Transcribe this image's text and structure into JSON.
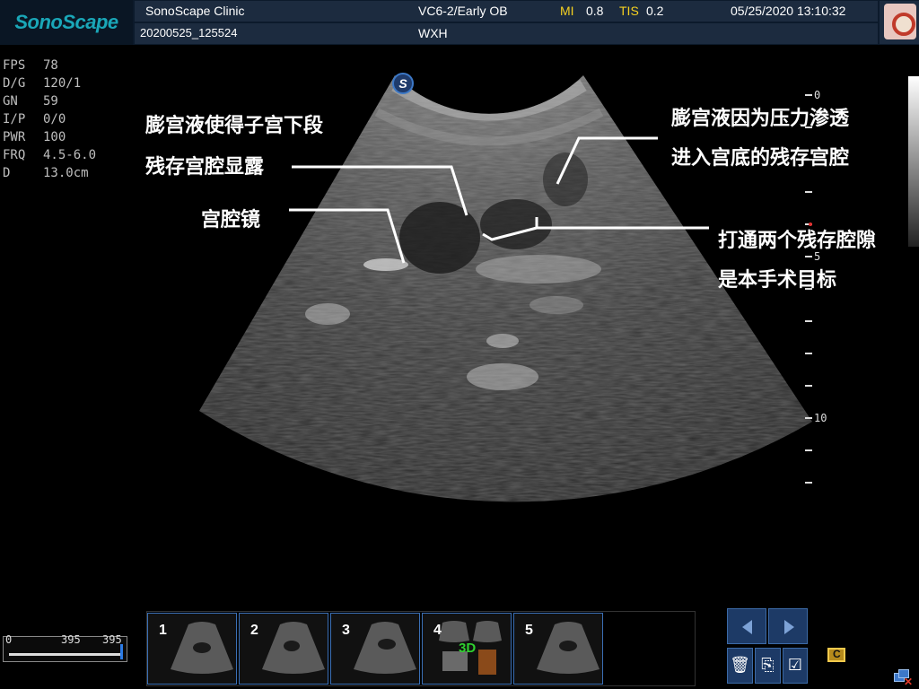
{
  "header": {
    "logo": "SonoScape",
    "clinic": "SonoScape Clinic",
    "probe_preset": "VC6-2/Early OB",
    "mi_label": "MI",
    "mi_value": "0.8",
    "tis_label": "TIS",
    "tis_value": "0.2",
    "datetime": "05/25/2020 13:10:32",
    "patient_id": "20200525_125524",
    "operator": "WXH"
  },
  "params": [
    {
      "key": "FPS",
      "value": "78"
    },
    {
      "key": "D/G",
      "value": "120/1"
    },
    {
      "key": "GN",
      "value": "59"
    },
    {
      "key": "I/P",
      "value": "0/0"
    },
    {
      "key": "PWR",
      "value": "100"
    },
    {
      "key": "FRQ",
      "value": "4.5-6.0"
    },
    {
      "key": "D",
      "value": "13.0cm"
    }
  ],
  "image": {
    "badge": "S",
    "depth_labels": [
      "0",
      "5",
      "10"
    ]
  },
  "annotations": {
    "a1_line1": "膨宫液使得子宫下段",
    "a1_line2": "残存宫腔显露",
    "a2": "宫腔镜",
    "a3_line1": "膨宫液因为压力渗透",
    "a3_line2": "进入宫底的残存宫腔",
    "a4_line1": "打通两个残存腔隙",
    "a4_line2": "是本手术目标"
  },
  "cine": {
    "start": "0",
    "current": "395",
    "total": "395",
    "position_fraction": 1.0
  },
  "thumbnails": [
    {
      "num": "1"
    },
    {
      "num": "2"
    },
    {
      "num": "3"
    },
    {
      "num": "4",
      "tag": "3D"
    },
    {
      "num": "5"
    }
  ],
  "icons": {
    "prev": "chevron-left-icon",
    "next": "chevron-right-icon",
    "delete": "trash-icon",
    "export": "export-icon",
    "checklist": "checklist-icon",
    "film": "film-icon",
    "network": "network-icon"
  }
}
